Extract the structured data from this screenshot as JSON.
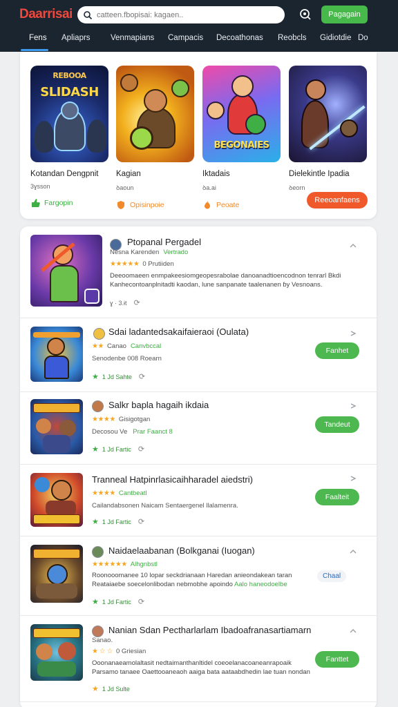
{
  "header": {
    "logo": "Daarrisai",
    "search_placeholder": "catteen.fbopisai: kagaen..",
    "cta_label": "Pagagain"
  },
  "tabs": [
    "Fens",
    "Apliaprs",
    "Venmapians",
    "Campacis",
    "Decoathonas",
    "Reobcls",
    "Gidiotdie",
    "Do"
  ],
  "featured": {
    "items": [
      {
        "name": "Kotandan Dengpnit",
        "sub": "3ɣsson",
        "badge": "Fargopin",
        "badge_color": "#3fae44",
        "art_title": "SLIDASH",
        "art_sub": "REBOOA"
      },
      {
        "name": "Kagian",
        "sub": "ꝺaoun",
        "badge": "Opisinpoie",
        "badge_color": "#f08a2a",
        "art_title": "",
        "art_sub": ""
      },
      {
        "name": "Iktadais",
        "sub": "ꝺa.ai",
        "badge": "Peoate",
        "badge_color": "#f08a2a",
        "art_title": "BEGONAIES",
        "art_sub": ""
      },
      {
        "name": "Dielekintle Ipadia",
        "sub": "ꝺeorn",
        "badge": "",
        "badge_color": "",
        "art_title": "",
        "art_sub": ""
      }
    ],
    "button_label": "Reeoanfaens"
  },
  "list": [
    {
      "title": "Ptopanal Pergadel",
      "meta_line": "Nesna Karenden",
      "meta_tag": "Vertrado",
      "rating_label": "0 Prutiiden",
      "desc": "Deeoomaeen enmpakeesiomgeopesrabolae danoanadtioencodnon tenrarl Bkdi Kanhecontoanplnitadti kaodan, lune sanpanate taalenanen ɓy Vesnoans.",
      "foot_a": "ɣ · 3.ɨt",
      "button": ""
    },
    {
      "title": "Sdai ladantedsakaifaieraoi (Oulata)",
      "meta_line": "Canao",
      "meta_tag": "Canvbccal",
      "rating_label": "",
      "desc": "Senodenbe 008 Roearn",
      "foot_a": "1 Jd Sahte",
      "button": "Fanhet"
    },
    {
      "title": "Salkr bapla hagaih ikdaia",
      "meta_line": "",
      "meta_tag": "",
      "rating_label": "Gisigotgan",
      "desc": "Decosou Ve",
      "desc_tag": "Prar Faanct 8",
      "foot_a": "1 Jd Fartic",
      "button": "Tandeut"
    },
    {
      "title": "Tranneal Hatpinrlasicaihharadel aiedstri)",
      "meta_line": "",
      "meta_tag": "Cantbeatl",
      "rating_label": "",
      "desc": "Cailandabsonen Naicam Sentaergenel llalamenra.",
      "foot_a": "1 Jd Fartic",
      "button": "Faalteit"
    },
    {
      "title": "Naidaelaabanan (Bolkganai (Iuogan)",
      "meta_line": "",
      "meta_tag": "Alhgnbstl",
      "rating_label": "",
      "desc": "Roonooomanee 10 lopar seckdrianaan Haredan anieondakean taran Reataiaebe soecelonlibodan nebmobhe apoindo",
      "desc_tag": "Aalo haneodoelbe",
      "chip": "Chaal",
      "foot_a": "1 Jd Fartic",
      "button": ""
    },
    {
      "title": "Nanian Sdan Pectharlarlam Ibadoafranasartiamarn",
      "meta_line": "Sanao.",
      "meta_tag": "",
      "rating_label": "0 Griesian",
      "desc": "Ooonanaeamolaltasit nedtaimanthanltidel coeoelanacoaneanrapoaik Parsamo tanaee Oaettooaneaoh aaiga bata aataabdhedin lae tuan nondan",
      "foot_a": "1 Jd Sulte",
      "button": "Fanttet"
    }
  ]
}
